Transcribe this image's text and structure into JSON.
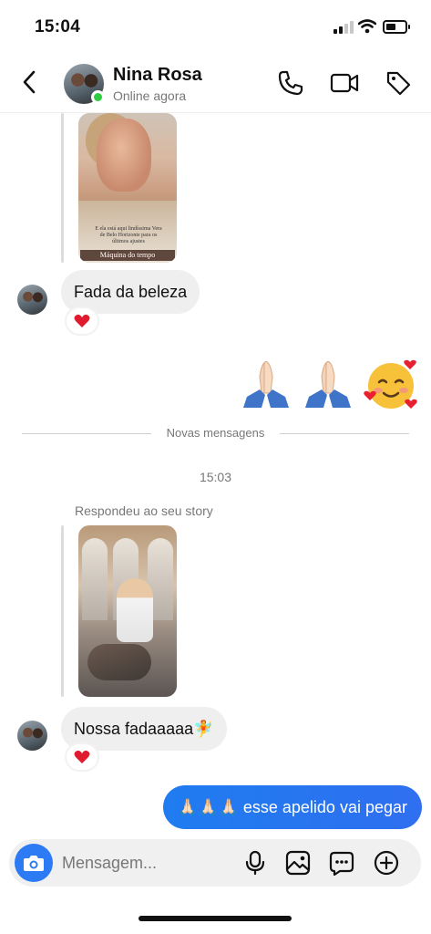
{
  "status_bar": {
    "time": "15:04"
  },
  "header": {
    "contact_name": "Nina Rosa",
    "contact_status": "Online agora",
    "icons": [
      "back-icon",
      "phone-icon",
      "video-icon",
      "tag-icon"
    ]
  },
  "messages": {
    "story1_caption": "E ela está aqui lindíssima Vera de Belo Horizonte para os últimos ajustes",
    "story1_tag": "Máquina do tempo",
    "message1": "Fada da beleza",
    "message1_reaction": "❤️",
    "sent_emojis": [
      "🙏🏻",
      "🙏🏻",
      "🥰"
    ],
    "divider_label": "Novas mensagens",
    "timestamp": "15:03",
    "replied_label": "Respondeu ao seu story",
    "message2": "Nossa fadaaaaa🧚",
    "message2_reaction": "❤️",
    "sent_message": "🙏🏻🙏🏻🙏🏻 esse apelido vai pegar"
  },
  "composer": {
    "placeholder": "Mensagem...",
    "icons": [
      "camera-icon",
      "microphone-icon",
      "image-icon",
      "sticker-icon",
      "plus-icon"
    ]
  },
  "colors": {
    "accent": "#2d7bf4",
    "online": "#2ecc40",
    "bubble_in": "#efefef"
  }
}
